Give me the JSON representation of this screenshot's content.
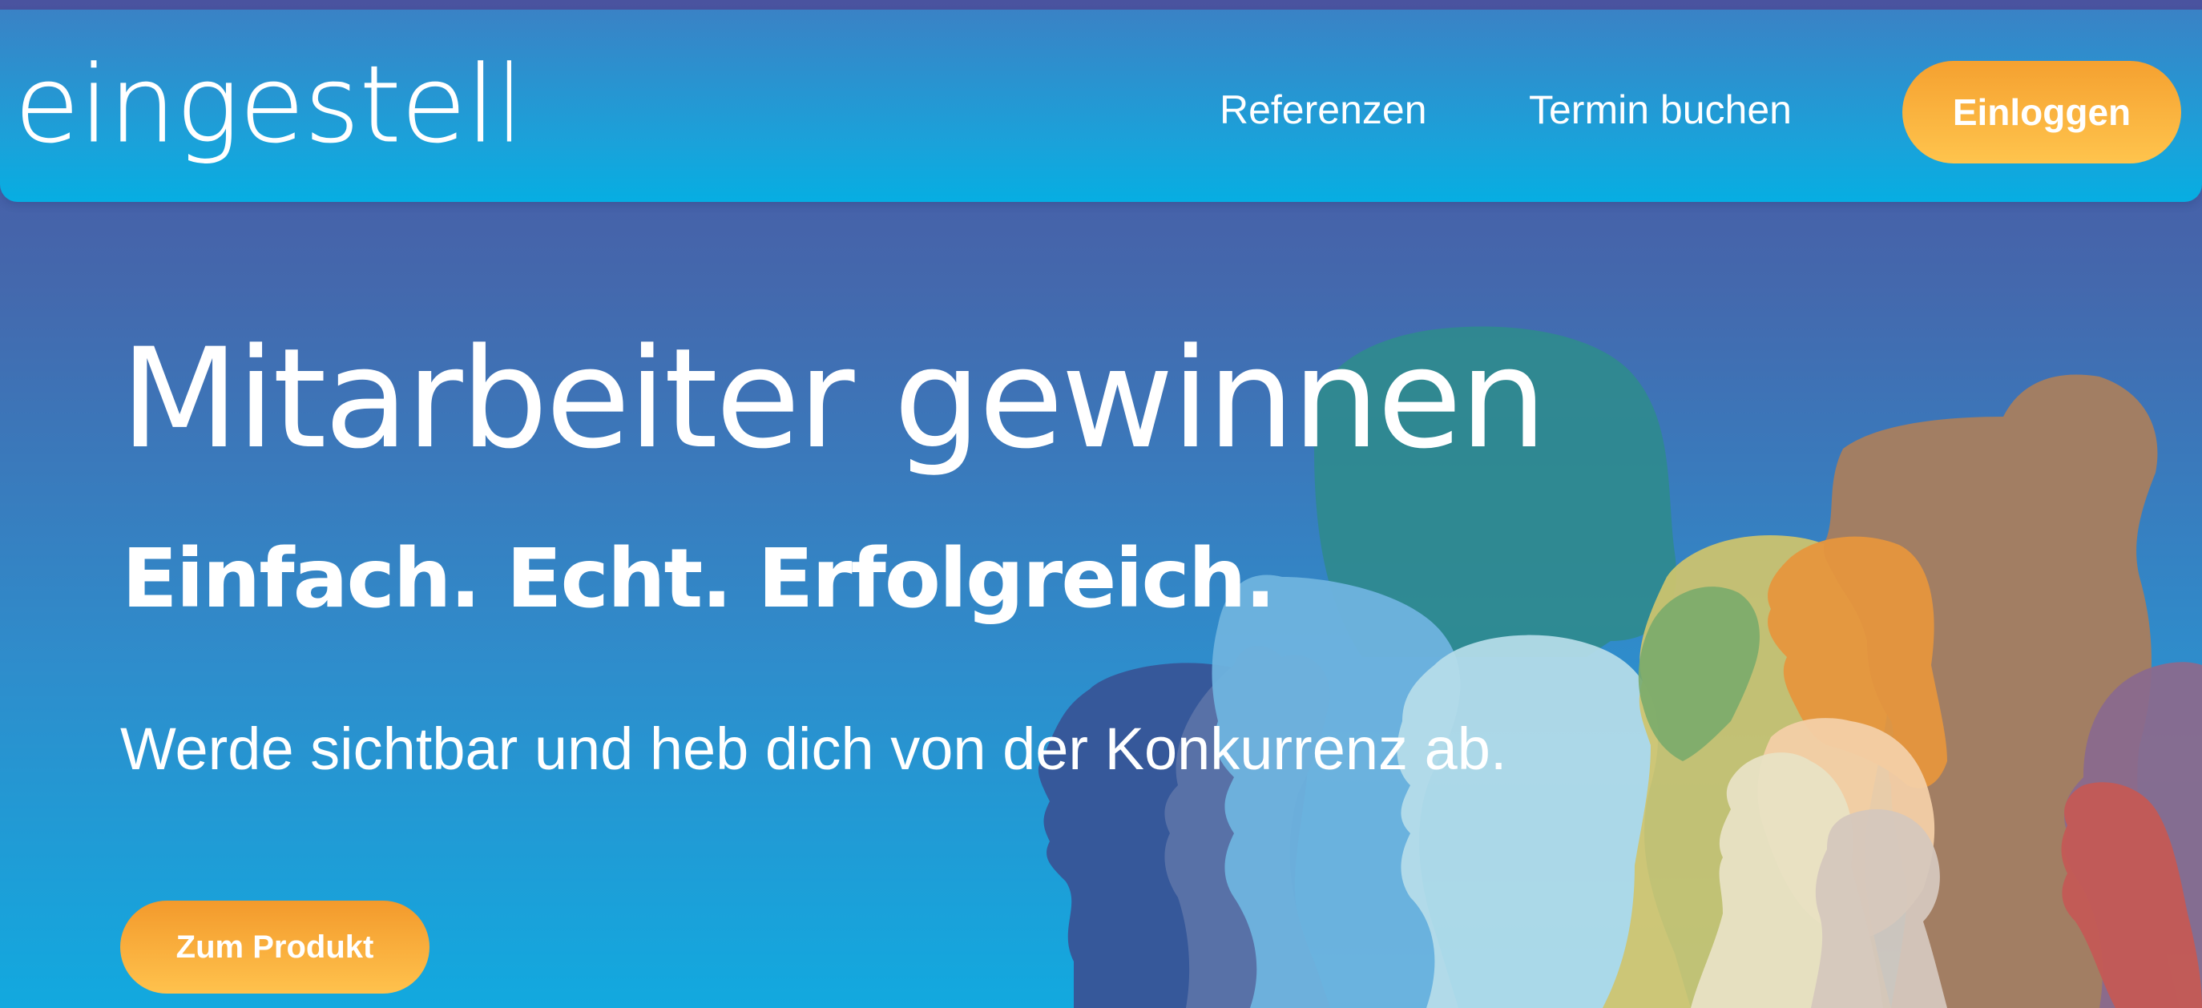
{
  "brand": {
    "logo_text": "eingestellt"
  },
  "nav": {
    "items": [
      {
        "label": "Referenzen"
      },
      {
        "label": "Termin buchen"
      }
    ],
    "login_label": "Einloggen"
  },
  "hero": {
    "title": "Mitarbeiter gewinnen",
    "subtitle": "Einfach. Echt. Erfolgreich.",
    "text": "Werde sichtbar und heb dich von der Konkurrenz ab.",
    "cta_label": "Zum Produkt",
    "illustration": "people-silhouettes-illustration"
  },
  "colors": {
    "background_top": "#4a539f",
    "background_bottom": "#12a9df",
    "header": "#1aa2da",
    "button_orange": "#f5a130",
    "button_yellow": "#ffc44d",
    "text": "#ffffff"
  }
}
